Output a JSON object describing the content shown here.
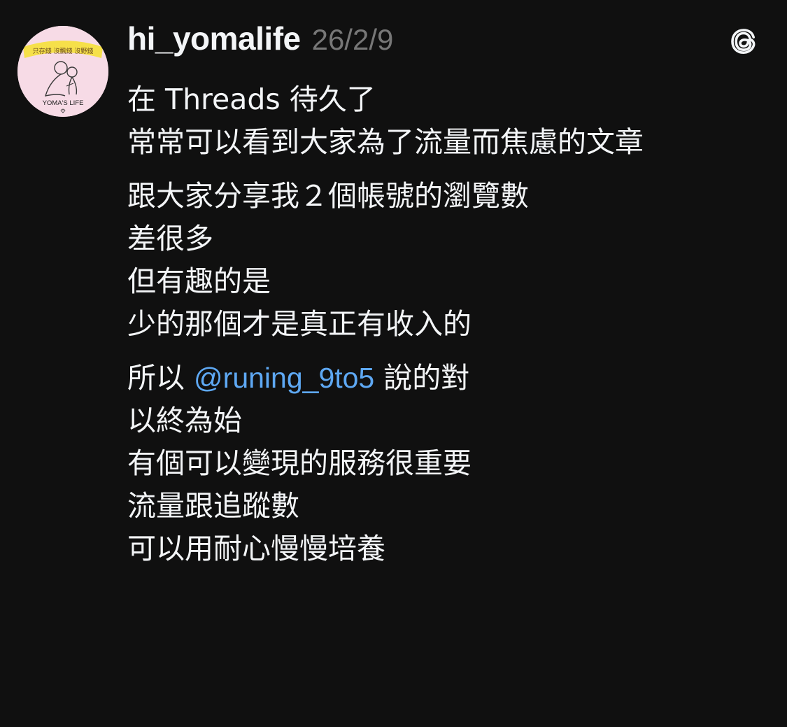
{
  "post": {
    "author": {
      "username": "hi_yomalife",
      "avatar": {
        "banner_text": "只存錢 沒飄錢 沒野錢",
        "brand_text": "YOMA'S LIFE"
      }
    },
    "timestamp": "26/2/9",
    "app_icon": "threads-logo-icon",
    "body": {
      "p1": {
        "l1": "在 Threads 待久了",
        "l2": "常常可以看到大家為了流量而焦慮的文章"
      },
      "p2": {
        "l1": "跟大家分享我２個帳號的瀏覽數",
        "l2": "差很多",
        "l3": "但有趣的是",
        "l4": "少的那個才是真正有收入的"
      },
      "p3": {
        "l1_prefix": "所以 ",
        "l1_mention": "@runing_9to5",
        "l1_suffix": " 說的對",
        "l2": "以終為始",
        "l3": "有個可以變現的服務很重要",
        "l4": "流量跟追蹤數",
        "l5": "可以用耐心慢慢培養"
      }
    }
  },
  "colors": {
    "background": "#101010",
    "text": "#f3f5f7",
    "muted": "#777777",
    "mention": "#5ea8f3",
    "avatar_bg": "#f7dbe6",
    "avatar_banner": "#f6e04a"
  }
}
